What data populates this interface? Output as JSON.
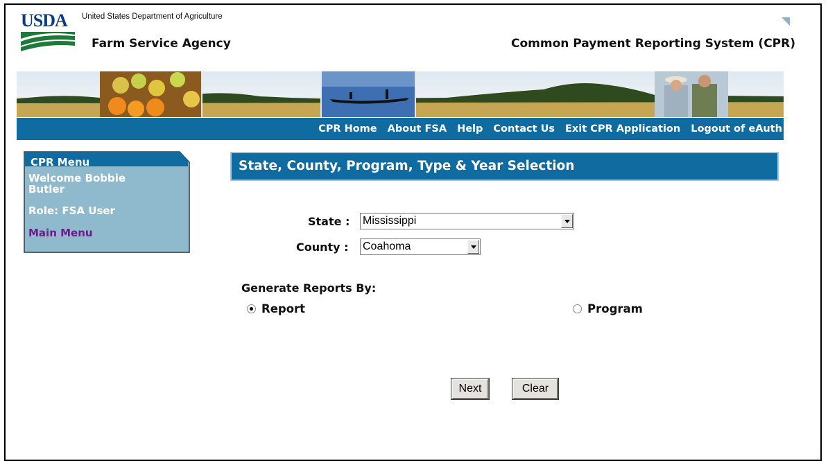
{
  "header": {
    "logo_text": "USDA",
    "department": "United States Department of Agriculture",
    "agency": "Farm Service Agency",
    "system_title": "Common Payment Reporting System (CPR)"
  },
  "nav": {
    "items": [
      "CPR Home",
      "About FSA",
      "Help",
      "Contact Us",
      "Exit CPR Application",
      "Logout of eAuth"
    ]
  },
  "menu": {
    "title": "CPR Menu",
    "welcome": "Welcome Bobbie Butler",
    "role": "Role: FSA User",
    "main_menu": "Main Menu"
  },
  "page": {
    "title": "State, County, Program, Type & Year Selection"
  },
  "form": {
    "state_label": "State :",
    "state_value": "Mississippi",
    "county_label": "County :",
    "county_value": "Coahoma",
    "generate_label": "Generate Reports By:",
    "radio_report": "Report",
    "radio_program": "Program",
    "selected_option": "Report",
    "next_label": "Next",
    "clear_label": "Clear"
  },
  "colors": {
    "nav_bar": "#0f6ba0",
    "menu_panel": "#8fb9cc",
    "main_menu_link": "#6b1d8a"
  }
}
